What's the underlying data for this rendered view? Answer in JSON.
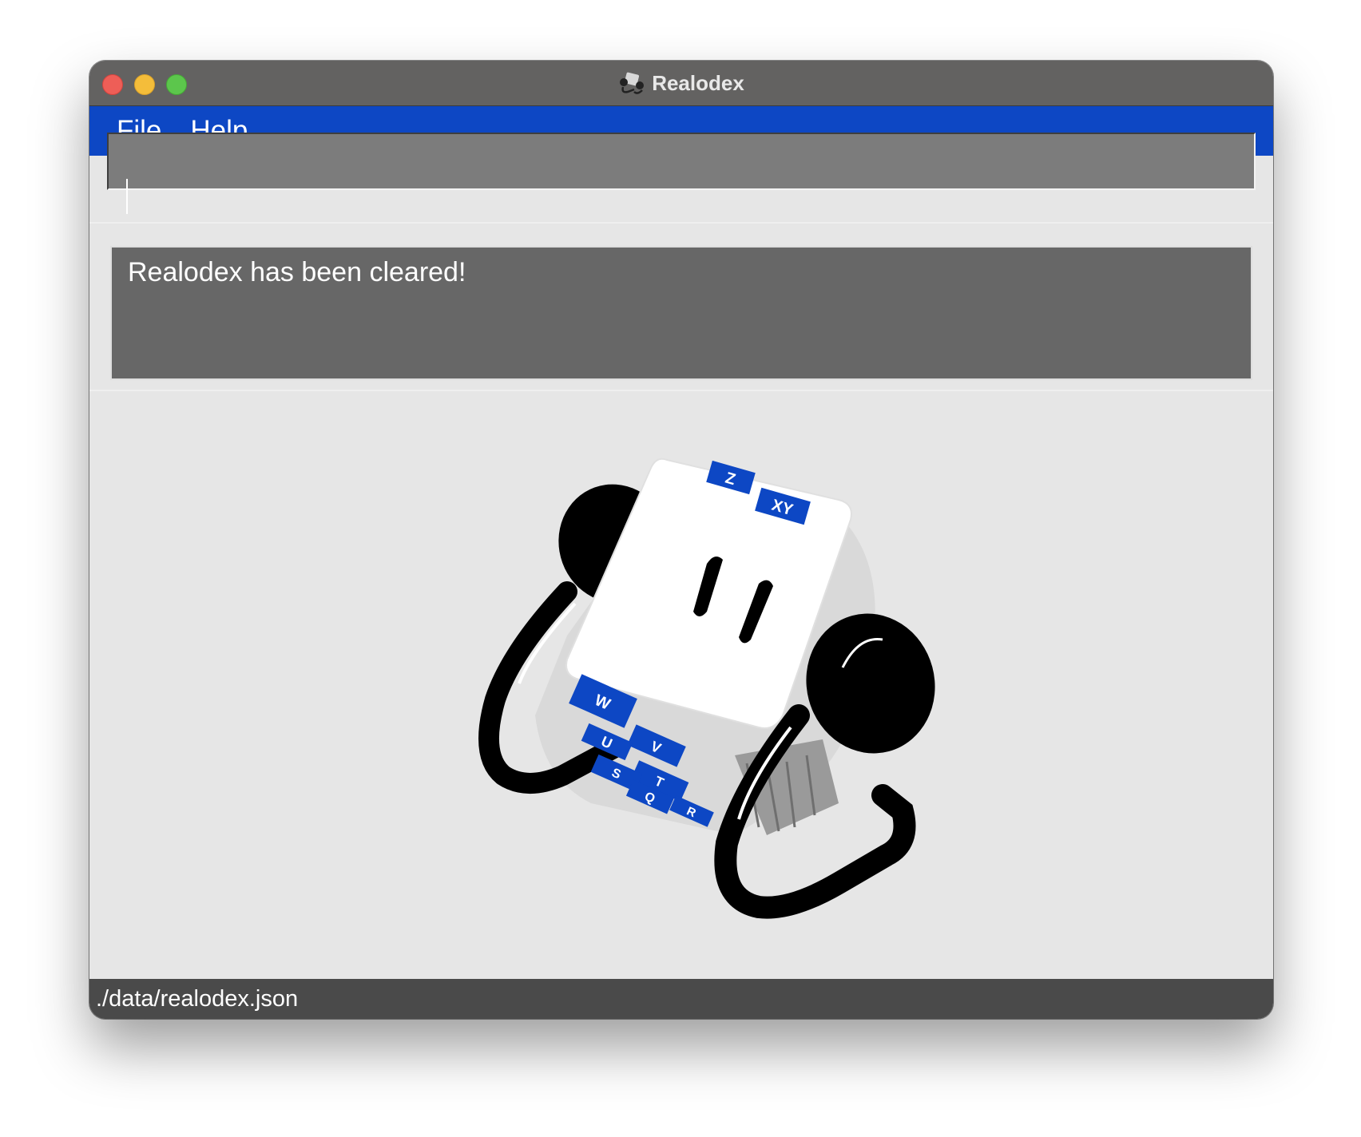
{
  "window": {
    "title": "Realodex",
    "app_icon": "rolodex-icon"
  },
  "menu": {
    "items": [
      {
        "label": "File"
      },
      {
        "label": "Help"
      }
    ]
  },
  "command_box": {
    "value": "",
    "placeholder": ""
  },
  "result_display": {
    "message": "Realodex has been cleared!"
  },
  "illustration": {
    "icon": "rolodex-illustration",
    "tabs": [
      "Z",
      "XY",
      "W",
      "V",
      "U",
      "T",
      "S",
      "Q",
      "R"
    ]
  },
  "status_bar": {
    "path": "./data/realodex.json"
  },
  "colors": {
    "accent": "#0d47c4",
    "titlebar": "#636261",
    "command_bg": "#7c7c7c",
    "result_bg": "#676767",
    "status_bg": "#4a4a4a"
  }
}
